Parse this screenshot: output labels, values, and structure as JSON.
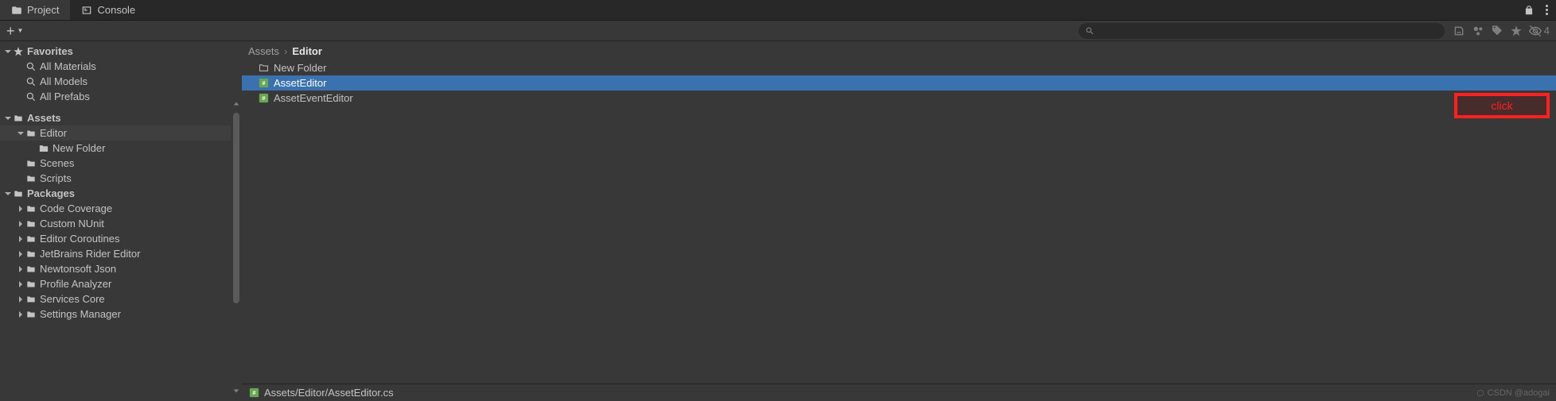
{
  "tabs": {
    "project": "Project",
    "console": "Console"
  },
  "search": {
    "placeholder": ""
  },
  "hidden_count": "4",
  "sidebar": {
    "favorites": {
      "label": "Favorites",
      "items": [
        "All Materials",
        "All Models",
        "All Prefabs"
      ]
    },
    "assets": {
      "label": "Assets",
      "editor": "Editor",
      "new_folder": "New Folder",
      "scenes": "Scenes",
      "scripts": "Scripts"
    },
    "packages": {
      "label": "Packages",
      "items": [
        "Code Coverage",
        "Custom NUnit",
        "Editor Coroutines",
        "JetBrains Rider Editor",
        "Newtonsoft Json",
        "Profile Analyzer",
        "Services Core",
        "Settings Manager"
      ]
    }
  },
  "breadcrumb": {
    "root": "Assets",
    "current": "Editor"
  },
  "content": {
    "items": [
      {
        "name": "New Folder",
        "type": "folder",
        "selected": false
      },
      {
        "name": "AssetEditor",
        "type": "script",
        "selected": true
      },
      {
        "name": "AssetEventEditor",
        "type": "script",
        "selected": false
      }
    ]
  },
  "callout": "click",
  "statusbar": {
    "path": "Assets/Editor/AssetEditor.cs",
    "watermark": "CSDN @adogai"
  }
}
